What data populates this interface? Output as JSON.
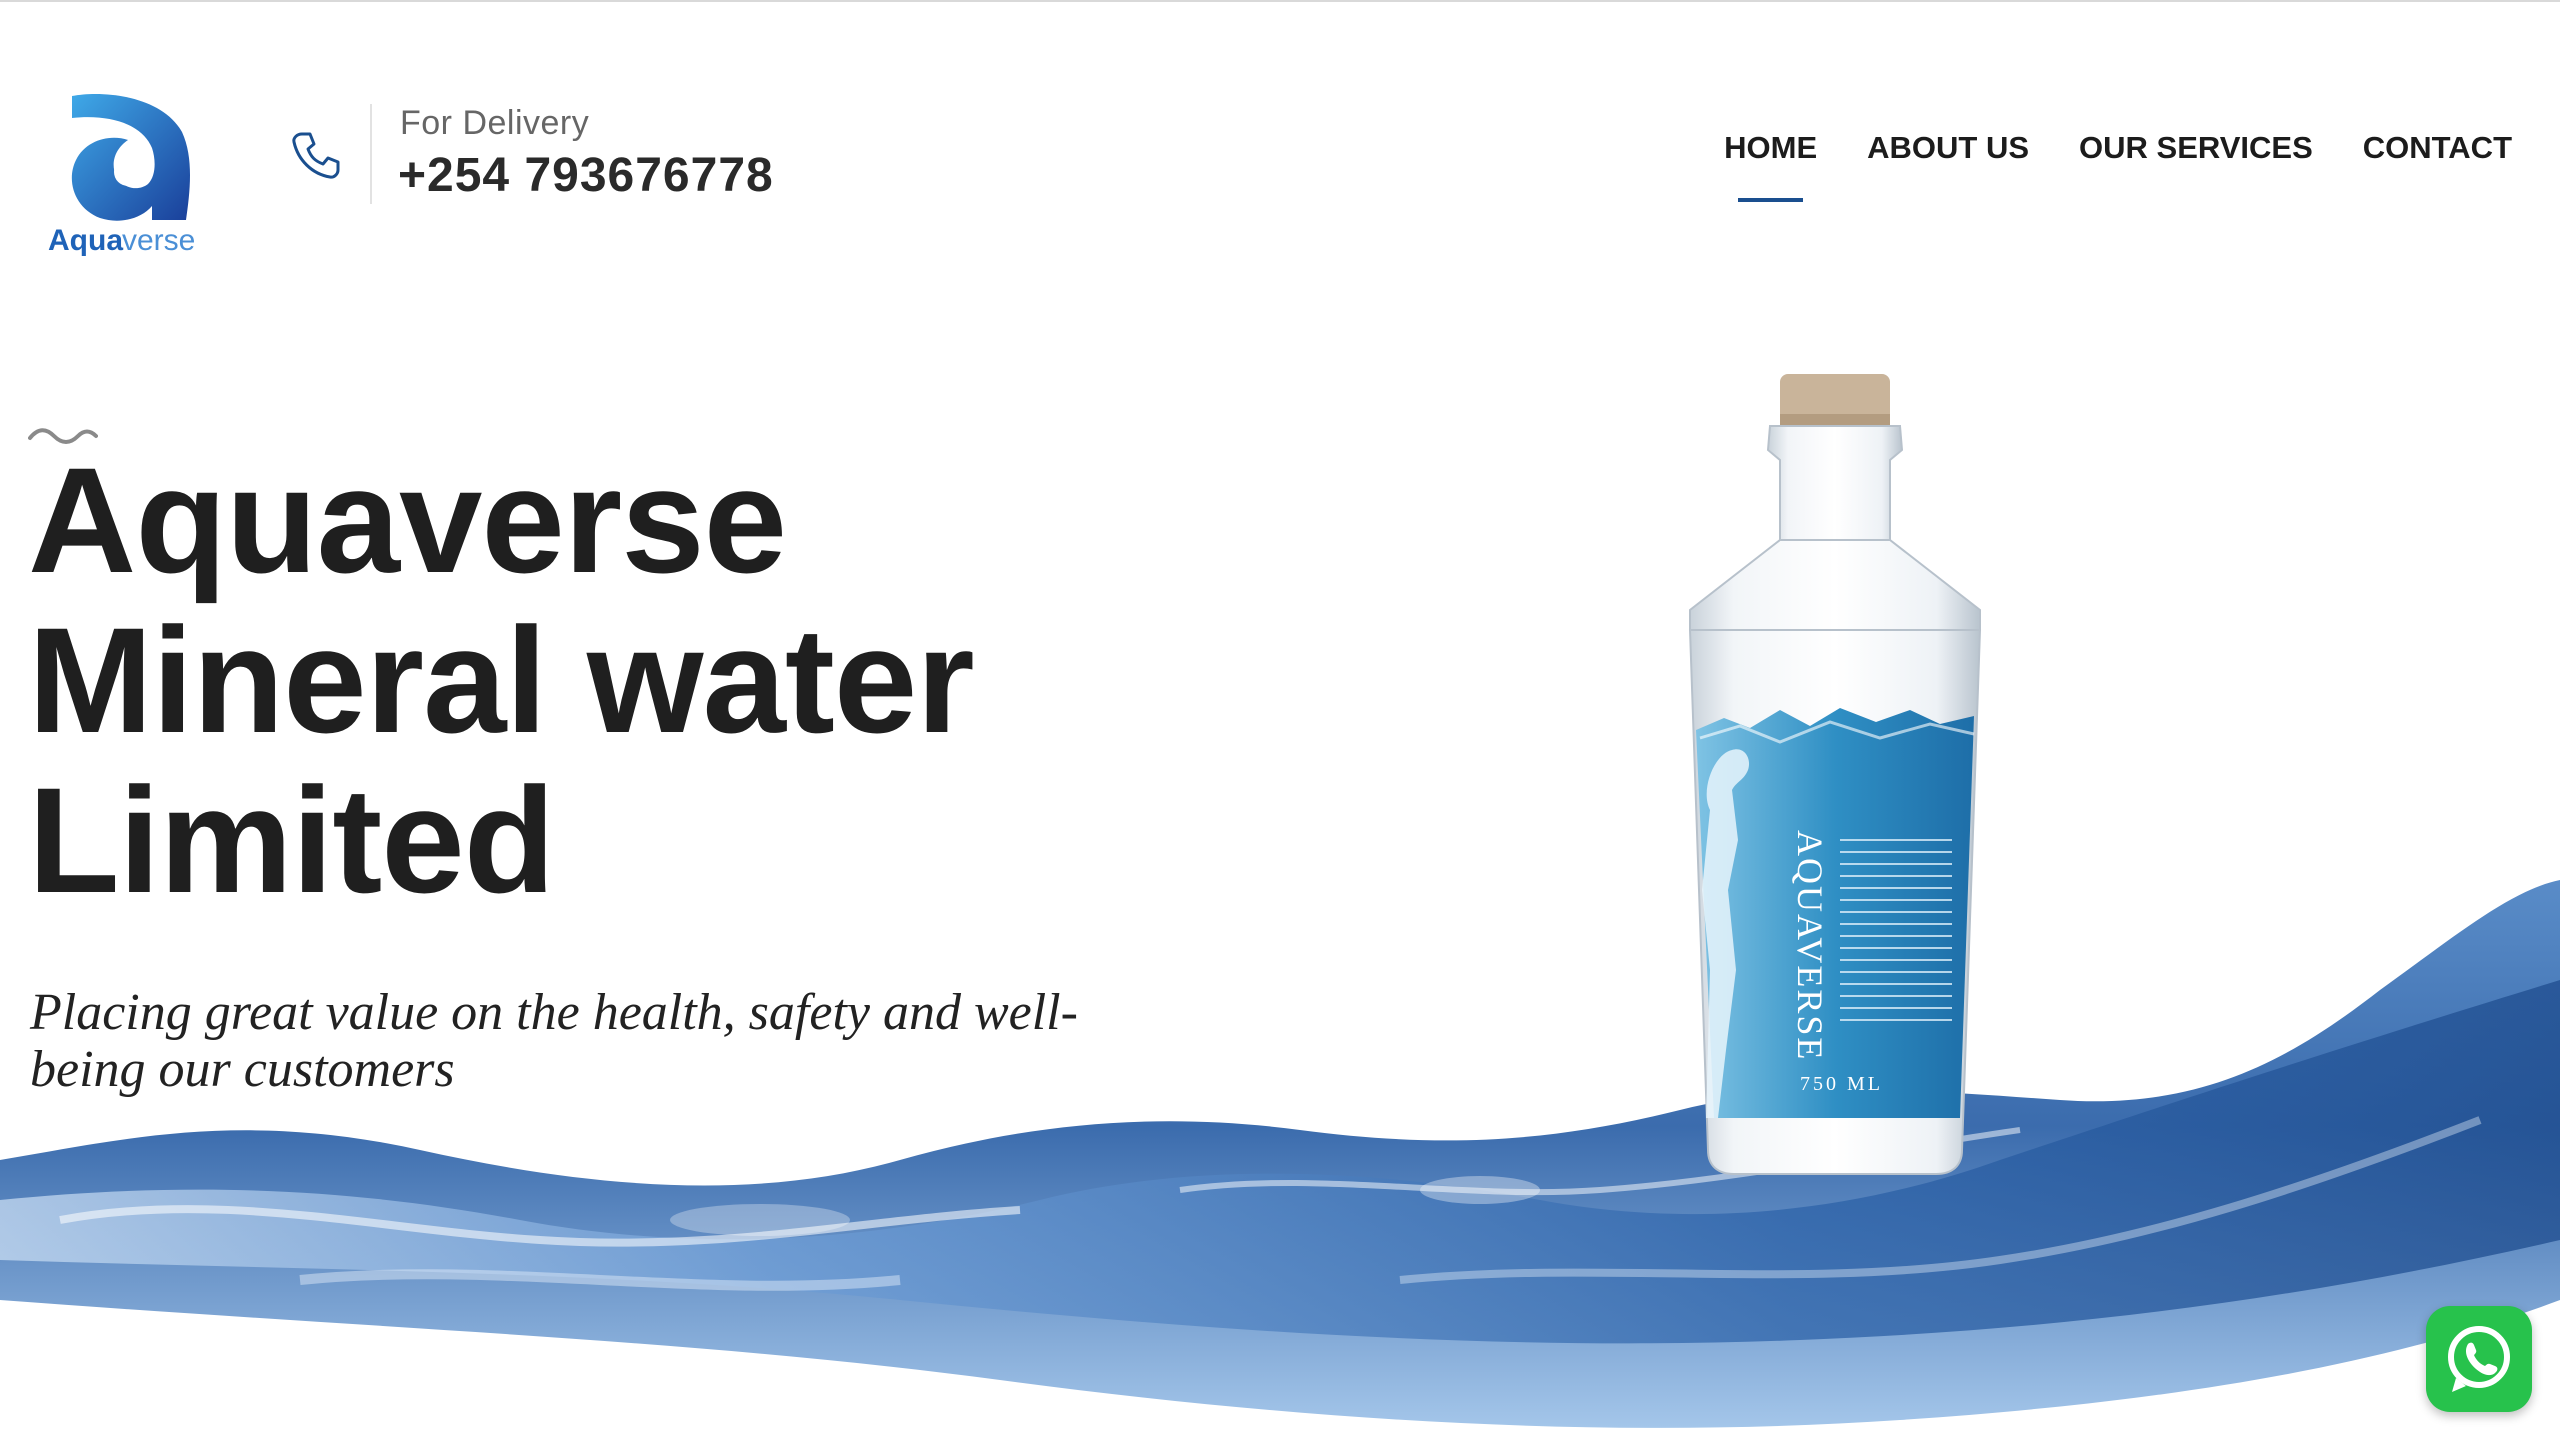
{
  "brand": {
    "name_bold": "Aqua",
    "name_light": "verse",
    "colors": {
      "primary": "#1a4f8f",
      "accent": "#2b8fd4",
      "text": "#1f1f1f"
    }
  },
  "header": {
    "delivery_label": "For Delivery",
    "delivery_phone": "+254 793676778",
    "phone_icon": "phone-icon"
  },
  "nav": {
    "items": [
      {
        "label": "HOME",
        "active": true
      },
      {
        "label": "ABOUT US",
        "active": false
      },
      {
        "label": "OUR SERVICES",
        "active": false
      },
      {
        "label": "CONTACT",
        "active": false
      }
    ]
  },
  "hero": {
    "title_line1": "Aquaverse",
    "title_line2": "Mineral water",
    "title_line3": "Limited",
    "subtitle": "Placing great value on the health, safety and well-being our customers"
  },
  "product": {
    "label_brand": "AQUAVERSE",
    "label_volume": "750 ML"
  },
  "floating": {
    "whatsapp_icon": "whatsapp-icon",
    "whatsapp_color": "#27c24c"
  }
}
